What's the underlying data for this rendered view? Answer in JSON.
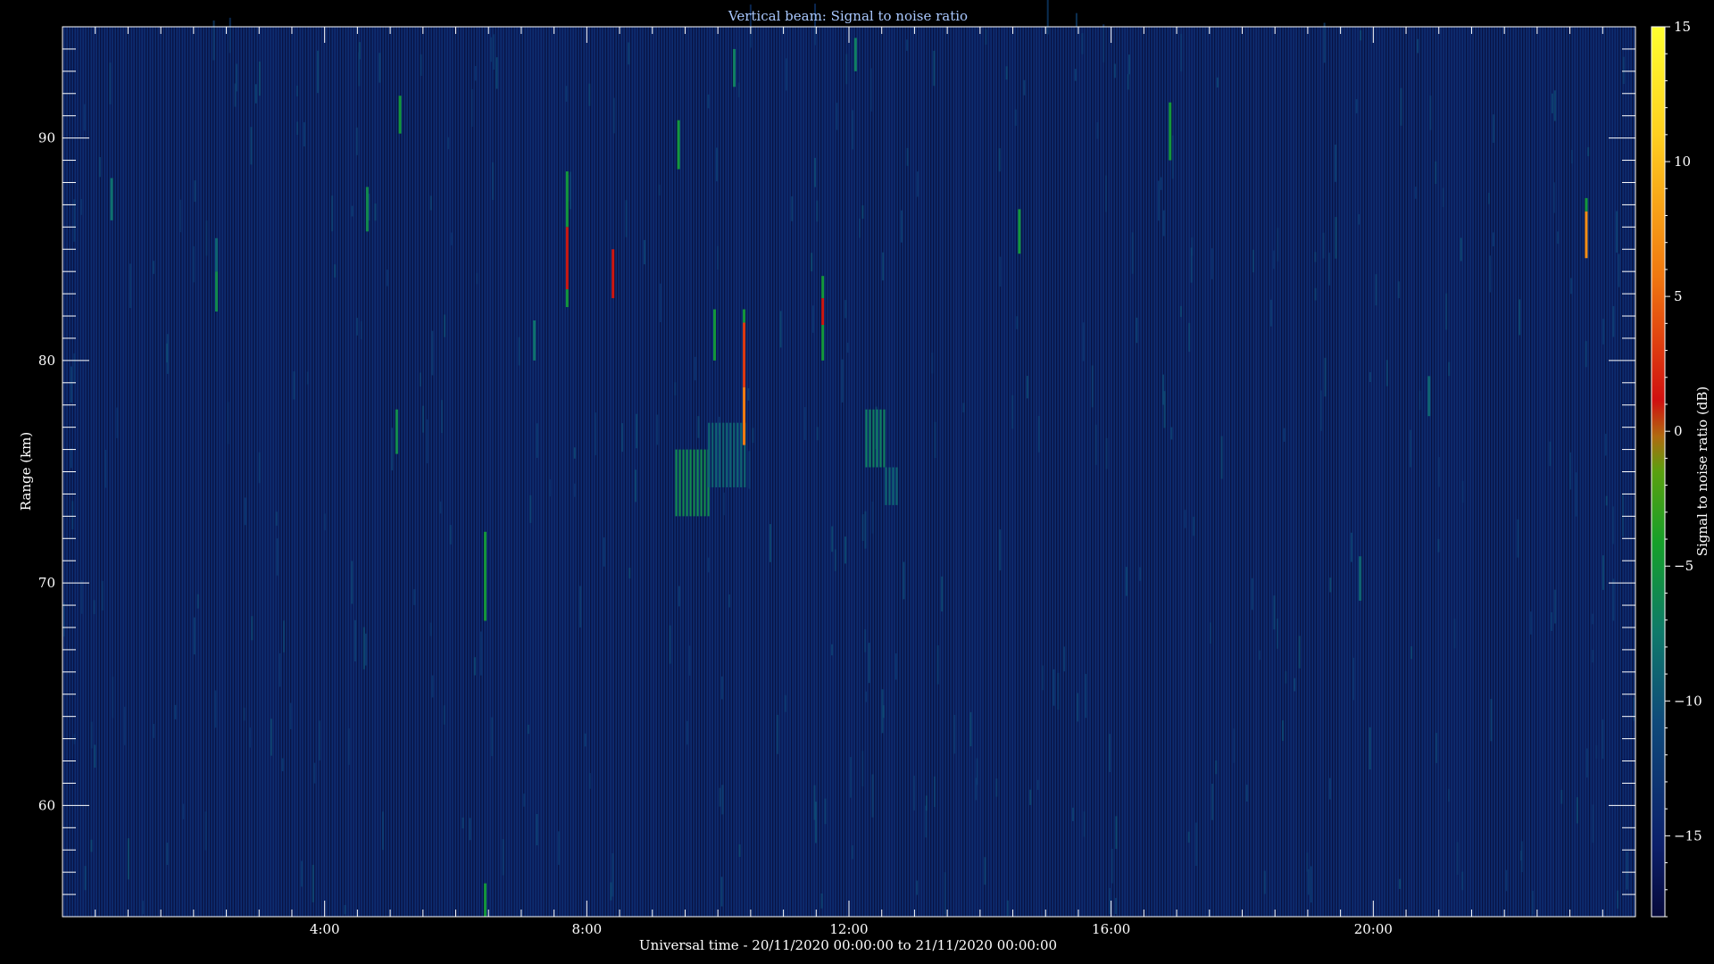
{
  "chart_data": {
    "type": "heatmap",
    "title": "Vertical beam: Signal to noise ratio",
    "xlabel": "Universal time - 20/11/2020 00:00:00 to 21/11/2020 00:00:00",
    "ylabel": "Range (km)",
    "colorbar_label": "Signal to noise ratio (dB)",
    "xlim": [
      0,
      24
    ],
    "ylim": [
      55,
      95
    ],
    "x_ticks": [
      {
        "value": 4,
        "label": "4:00"
      },
      {
        "value": 8,
        "label": "8:00"
      },
      {
        "value": 12,
        "label": "12:00"
      },
      {
        "value": 16,
        "label": "16:00"
      },
      {
        "value": 20,
        "label": "20:00"
      }
    ],
    "y_ticks": [
      {
        "value": 60,
        "label": "60"
      },
      {
        "value": 70,
        "label": "70"
      },
      {
        "value": 80,
        "label": "80"
      },
      {
        "value": 90,
        "label": "90"
      }
    ],
    "colorbar_range": [
      -18,
      15
    ],
    "colorbar_ticks": [
      {
        "value": 15,
        "label": "15"
      },
      {
        "value": 10,
        "label": "10"
      },
      {
        "value": 5,
        "label": "5"
      },
      {
        "value": 0,
        "label": "0"
      },
      {
        "value": -5,
        "label": "−5"
      },
      {
        "value": -10,
        "label": "−10"
      },
      {
        "value": -15,
        "label": "−15"
      }
    ],
    "background_snr_db": -14,
    "colormap": [
      "#06093a",
      "#0c1f6a",
      "#0f4a7a",
      "#0f7a6a",
      "#16a02a",
      "#5aa010",
      "#b06a10",
      "#d01010",
      "#f07810",
      "#ffd020",
      "#ffff30"
    ],
    "echoes": [
      {
        "t": 0.75,
        "r_top": 88.2,
        "r_bottom": 86.3,
        "snr": -8
      },
      {
        "t": 2.35,
        "r_top": 85.5,
        "r_bottom": 84.0,
        "snr": -9
      },
      {
        "t": 2.35,
        "r_top": 84.0,
        "r_bottom": 82.2,
        "snr": -6
      },
      {
        "t": 4.65,
        "r_top": 87.8,
        "r_bottom": 85.8,
        "snr": -6
      },
      {
        "t": 5.15,
        "r_top": 91.9,
        "r_bottom": 90.2,
        "snr": -5
      },
      {
        "t": 5.1,
        "r_top": 77.8,
        "r_bottom": 75.8,
        "snr": -6
      },
      {
        "t": 6.45,
        "r_top": 72.3,
        "r_bottom": 68.3,
        "snr": -5
      },
      {
        "t": 6.45,
        "r_top": 56.5,
        "r_bottom": 55.0,
        "snr": -5
      },
      {
        "t": 7.2,
        "r_top": 81.8,
        "r_bottom": 80.0,
        "snr": -8
      },
      {
        "t": 7.7,
        "r_top": 88.5,
        "r_bottom": 86.0,
        "snr": -5
      },
      {
        "t": 7.7,
        "r_top": 86.0,
        "r_bottom": 83.2,
        "snr": 1
      },
      {
        "t": 7.7,
        "r_top": 83.2,
        "r_bottom": 82.4,
        "snr": -5
      },
      {
        "t": 8.4,
        "r_top": 85.0,
        "r_bottom": 82.8,
        "snr": 1
      },
      {
        "t": 9.4,
        "r_top": 90.8,
        "r_bottom": 88.6,
        "snr": -5
      },
      {
        "t": 9.95,
        "r_top": 82.3,
        "r_bottom": 80.0,
        "snr": -5
      },
      {
        "t": 10.25,
        "r_top": 94.0,
        "r_bottom": 92.3,
        "snr": -7
      },
      {
        "t": 10.4,
        "r_top": 82.3,
        "r_bottom": 81.7,
        "snr": -5
      },
      {
        "t": 10.4,
        "r_top": 81.7,
        "r_bottom": 78.8,
        "snr": 3
      },
      {
        "t": 10.4,
        "r_top": 78.8,
        "r_bottom": 76.2,
        "snr": 6
      },
      {
        "t": 11.6,
        "r_top": 83.8,
        "r_bottom": 82.8,
        "snr": -5
      },
      {
        "t": 11.6,
        "r_top": 82.8,
        "r_bottom": 81.6,
        "snr": 1
      },
      {
        "t": 11.6,
        "r_top": 81.6,
        "r_bottom": 80.0,
        "snr": -5
      },
      {
        "t": 12.1,
        "r_top": 94.5,
        "r_bottom": 93.0,
        "snr": -7
      },
      {
        "t": 14.6,
        "r_top": 86.8,
        "r_bottom": 84.8,
        "snr": -5
      },
      {
        "t": 16.9,
        "r_top": 91.6,
        "r_bottom": 89.0,
        "snr": -5
      },
      {
        "t": 19.8,
        "r_top": 71.2,
        "r_bottom": 69.2,
        "snr": -9
      },
      {
        "t": 20.85,
        "r_top": 79.3,
        "r_bottom": 77.5,
        "snr": -9
      },
      {
        "t": 23.25,
        "r_top": 87.3,
        "r_bottom": 86.7,
        "snr": -5
      },
      {
        "t": 23.25,
        "r_top": 86.7,
        "r_bottom": 84.6,
        "snr": 7
      }
    ],
    "patches": [
      {
        "t_start": 9.35,
        "t_end": 9.85,
        "r_top": 76.0,
        "r_bottom": 73.0,
        "snr": -6
      },
      {
        "t_start": 9.85,
        "t_end": 10.4,
        "r_top": 77.2,
        "r_bottom": 74.3,
        "snr": -9
      },
      {
        "t_start": 12.25,
        "t_end": 12.55,
        "r_top": 77.8,
        "r_bottom": 75.2,
        "snr": -7
      },
      {
        "t_start": 12.55,
        "t_end": 12.75,
        "r_top": 75.2,
        "r_bottom": 73.5,
        "snr": -9
      }
    ]
  }
}
